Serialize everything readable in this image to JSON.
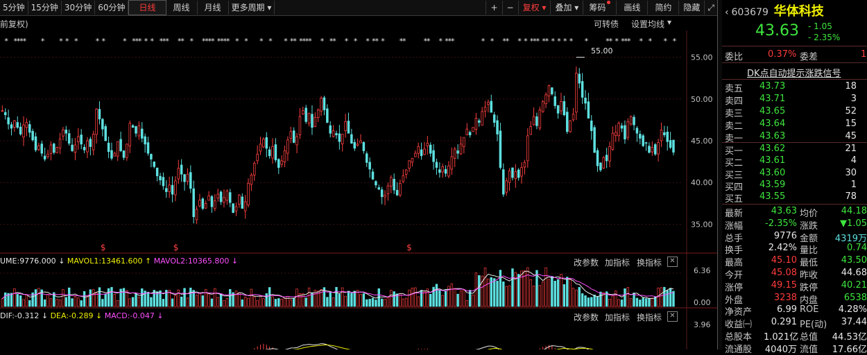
{
  "toolbar": {
    "periods": [
      {
        "label": "5分钟",
        "active": false
      },
      {
        "label": "15分钟",
        "active": false
      },
      {
        "label": "30分钟",
        "active": false
      },
      {
        "label": "60分钟",
        "active": false
      },
      {
        "label": "日线",
        "active": true
      },
      {
        "label": "周线",
        "active": false
      },
      {
        "label": "月线",
        "active": false
      },
      {
        "label": "更多周期",
        "active": false
      }
    ],
    "more_arrow": "▾",
    "plus": "+",
    "minus": "−",
    "fuquan": "复权",
    "dieja": "叠加",
    "chouma": "筹码",
    "huaxian": "画线",
    "jianyue": "简约",
    "yincang": "隐藏",
    "expand": "⤢",
    "dropdown_arrow": "▾"
  },
  "subbar": {
    "mode": "前复权)",
    "convertible": "可转债",
    "set_ma": "设置均线",
    "ma_arrow": "▾"
  },
  "main_chart": {
    "y_ticks": [
      "55.00",
      "50.00",
      "45.00",
      "40.00",
      "35.00"
    ],
    "y_values": [
      55,
      50,
      45,
      40,
      35
    ],
    "ylim": [
      31.8,
      58.2
    ],
    "peak_label": "55.00",
    "dollar_marker": "$",
    "star": "*",
    "up_color": "#ff4040",
    "down_color": "#5ee0e0"
  },
  "volume": {
    "name": "UME:9776.000",
    "mavol1": "MAVOL1:13461.600",
    "mavol2": "MAVOL2:10365.800",
    "down_arrow": "↓",
    "up_arrow": "↑",
    "y_ticks": [
      "6.36",
      "0.00"
    ],
    "btn_params": "改参数",
    "btn_add": "加指标",
    "btn_switch": "换指标",
    "close": "✕"
  },
  "macd": {
    "dif": "DIF:-0.312",
    "dea": "DEA:-0.289",
    "macd": "MACD:-0.047",
    "down_arrow": "↓",
    "y_tick": "3.96",
    "btn_params": "改参数",
    "btn_add": "加指标",
    "btn_switch": "换指标",
    "close": "✕"
  },
  "side": {
    "code": "603679",
    "name": "华体科技",
    "price": "43.63",
    "change": "- 1.05",
    "change_pct": "- 2.35%",
    "weibi_label": "委比",
    "weibi": "0.37%",
    "weicha_label": "委差",
    "weicha": "1",
    "dk": "DK点自动提示涨跌信号",
    "asks": [
      {
        "label": "卖五",
        "price": "43.73",
        "vol": "18"
      },
      {
        "label": "卖四",
        "price": "43.71",
        "vol": "3"
      },
      {
        "label": "卖三",
        "price": "43.65",
        "vol": "52"
      },
      {
        "label": "卖二",
        "price": "43.64",
        "vol": "15"
      },
      {
        "label": "卖一",
        "price": "43.63",
        "vol": "45"
      }
    ],
    "bids": [
      {
        "label": "买一",
        "price": "43.62",
        "vol": "21"
      },
      {
        "label": "买二",
        "price": "43.61",
        "vol": "4"
      },
      {
        "label": "买三",
        "price": "43.60",
        "vol": "30"
      },
      {
        "label": "买四",
        "price": "43.59",
        "vol": "1"
      },
      {
        "label": "买五",
        "price": "43.55",
        "vol": "78"
      }
    ],
    "stats": [
      {
        "l1": "最新",
        "v1": "43.63",
        "c1": "green",
        "l2": "均价",
        "v2": "44.18",
        "c2": "green"
      },
      {
        "l1": "涨幅",
        "v1": "-2.35%",
        "c1": "green",
        "l2": "涨跌",
        "v2": "▼1.05",
        "c2": "green"
      },
      {
        "l1": "总手",
        "v1": "9776",
        "c1": "white",
        "l2": "金额",
        "v2": "4319万",
        "c2": "cyan"
      },
      {
        "l1": "换手",
        "v1": "2.42%",
        "c1": "white",
        "l2": "量比",
        "v2": "0.74",
        "c2": "green"
      },
      {
        "l1": "最高",
        "v1": "45.10",
        "c1": "red",
        "l2": "最低",
        "v2": "43.50",
        "c2": "green"
      },
      {
        "l1": "今开",
        "v1": "45.08",
        "c1": "red",
        "l2": "昨收",
        "v2": "44.68",
        "c2": "white"
      },
      {
        "l1": "涨停",
        "v1": "49.15",
        "c1": "red",
        "l2": "跌停",
        "v2": "40.21",
        "c2": "green"
      },
      {
        "l1": "外盘",
        "v1": "3238",
        "c1": "red",
        "l2": "内盘",
        "v2": "6538",
        "c2": "green"
      },
      {
        "l1": "净资产",
        "v1": "6.99",
        "c1": "white",
        "l2": "ROE",
        "v2": "4.28%",
        "c2": "white"
      },
      {
        "l1": "收益㈠",
        "v1": "0.291",
        "c1": "white",
        "l2": "PE(动)",
        "v2": "37.44",
        "c2": "white"
      },
      {
        "l1": "总股本",
        "v1": "1.021亿",
        "c1": "white",
        "l2": "总值",
        "v2": "44.53亿",
        "c2": "white"
      },
      {
        "l1": "流通股",
        "v1": "4040万",
        "c1": "white",
        "l2": "流值",
        "v2": "17.66亿",
        "c2": "white"
      }
    ]
  },
  "chart_data": {
    "type": "candlestick",
    "ylim": [
      31.8,
      58.2
    ],
    "y_ticks": [
      55,
      50,
      45,
      40,
      35
    ],
    "close": [
      48.6,
      48.1,
      47.0,
      46.5,
      47.4,
      46.6,
      45.8,
      46.9,
      47.2,
      46.0,
      45.1,
      43.9,
      44.4,
      43.5,
      42.8,
      43.4,
      44.5,
      43.6,
      44.2,
      45.2,
      46.3,
      45.9,
      44.7,
      43.8,
      44.5,
      45.5,
      44.6,
      43.9,
      45.0,
      44.3,
      45.8,
      48.8,
      47.6,
      46.4,
      45.0,
      43.7,
      42.9,
      43.5,
      44.9,
      43.8,
      43.0,
      44.6,
      47.1,
      46.6,
      45.9,
      46.8,
      45.3,
      44.6,
      43.5,
      42.8,
      41.9,
      40.8,
      40.3,
      39.6,
      38.9,
      39.7,
      38.6,
      40.2,
      41.7,
      41.0,
      40.1,
      41.0,
      39.3,
      35.9,
      36.8,
      37.9,
      36.9,
      37.5,
      38.4,
      37.1,
      37.8,
      38.6,
      37.7,
      38.2,
      39.0,
      37.6,
      36.4,
      37.1,
      38.5,
      36.9,
      37.7,
      39.9,
      40.9,
      42.3,
      43.4,
      44.6,
      45.2,
      44.1,
      43.2,
      44.3,
      42.7,
      41.8,
      42.6,
      43.8,
      45.1,
      46.1,
      44.8,
      45.5,
      47.9,
      48.6,
      47.3,
      48.3,
      46.6,
      47.8,
      48.7,
      50.1,
      48.7,
      47.2,
      45.9,
      46.2,
      45.7,
      44.9,
      45.8,
      47.3,
      45.9,
      44.7,
      44.1,
      44.6,
      45.0,
      43.8,
      42.4,
      41.6,
      40.4,
      39.7,
      39.2,
      38.3,
      38.5,
      39.6,
      40.6,
      39.1,
      38.5,
      39.9,
      40.8,
      41.5,
      42.6,
      42.9,
      43.5,
      44.3,
      43.2,
      44.0,
      44.7,
      43.5,
      42.5,
      41.8,
      41.2,
      41.9,
      41.1,
      42.0,
      43.1,
      44.0,
      43.5,
      44.6,
      45.4,
      46.4,
      45.7,
      46.6,
      47.7,
      47.2,
      48.5,
      49.0,
      49.6,
      48.4,
      47.2,
      45.8,
      41.8,
      38.6,
      40.2,
      41.4,
      40.6,
      41.3,
      40.6,
      41.8,
      42.4,
      45.6,
      46.7,
      47.9,
      46.8,
      48.7,
      49.7,
      50.5,
      51.6,
      50.6,
      49.2,
      48.3,
      49.7,
      48.1,
      46.1,
      47.4,
      48.2,
      53.1,
      51.9,
      50.2,
      49.5,
      47.7,
      46.2,
      43.6,
      42.0,
      41.5,
      43.0,
      42.6,
      44.3,
      45.9,
      46.0,
      47.1,
      46.5,
      45.2,
      47.3,
      47.9,
      46.9,
      45.9,
      45.3,
      44.4,
      44.7,
      43.6,
      44.2,
      43.4,
      44.8,
      46.3,
      45.7,
      44.9,
      44.2,
      43.63
    ]
  }
}
